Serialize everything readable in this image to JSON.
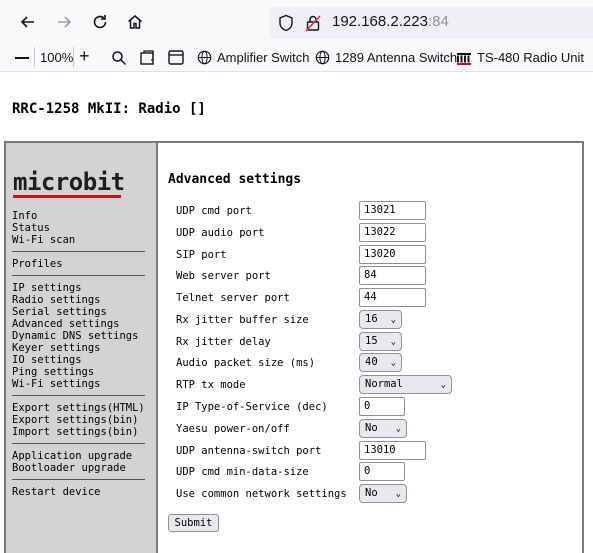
{
  "browser": {
    "url_host": "192.168.2.223",
    "url_port": ":84",
    "zoom": "100%",
    "bookmarks": [
      {
        "label": "Amplifier Switch"
      },
      {
        "label": "1289 Antenna Switch"
      },
      {
        "label": "TS-480 Radio Unit"
      }
    ]
  },
  "page": {
    "title": "RRC-1258 MkII: Radio []"
  },
  "sidebar": {
    "logo": "microbit",
    "logo_underline_color": "#c0151b",
    "groups": [
      [
        "Info",
        "Status",
        "Wi-Fi scan"
      ],
      [
        "Profiles"
      ],
      [
        "IP settings",
        "Radio settings",
        "Serial settings",
        "Advanced settings",
        "Dynamic DNS settings",
        "Keyer settings",
        "IO settings",
        "Ping settings",
        "Wi-Fi settings"
      ],
      [
        "Export settings(HTML)",
        "Export settings(bin)",
        "Import settings(bin)"
      ],
      [
        "Application upgrade",
        "Bootloader upgrade"
      ],
      [
        "Restart device"
      ]
    ]
  },
  "main": {
    "heading": "Advanced settings",
    "rows": [
      {
        "label": "UDP cmd port",
        "value": "13021",
        "kind": "text"
      },
      {
        "label": "UDP audio port",
        "value": "13022",
        "kind": "text"
      },
      {
        "label": "SIP port",
        "value": "13020",
        "kind": "text"
      },
      {
        "label": "Web server port",
        "value": "84",
        "kind": "text"
      },
      {
        "label": "Telnet server port",
        "value": "44",
        "kind": "text"
      },
      {
        "label": "Rx jitter buffer size",
        "value": "16",
        "kind": "select"
      },
      {
        "label": "Rx jitter delay",
        "value": "15",
        "kind": "select"
      },
      {
        "label": "Audio packet size (ms)",
        "value": "40",
        "kind": "select"
      },
      {
        "label": "RTP tx mode",
        "value": "Normal",
        "kind": "select"
      },
      {
        "label": "IP Type-of-Service (dec)",
        "value": "0",
        "kind": "text"
      },
      {
        "label": "Yaesu power-on/off",
        "value": "No",
        "kind": "select"
      },
      {
        "label": "UDP antenna-switch port",
        "value": "13010",
        "kind": "text"
      },
      {
        "label": "UDP cmd min-data-size",
        "value": "0",
        "kind": "text"
      },
      {
        "label": "Use common network settings",
        "value": "No",
        "kind": "select"
      }
    ],
    "submit_label": "Submit"
  }
}
